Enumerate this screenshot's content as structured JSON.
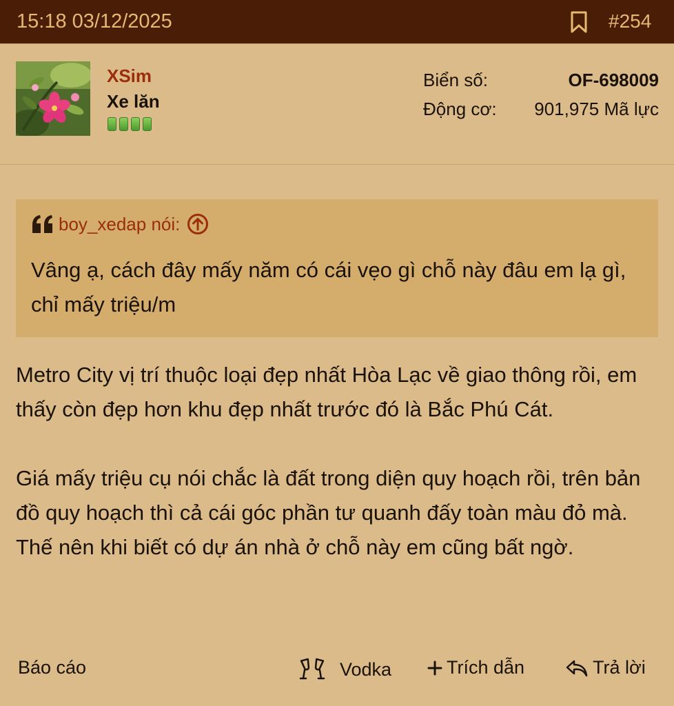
{
  "header": {
    "timestamp": "15:18 03/12/2025",
    "post_number": "#254",
    "bookmark_icon": "bookmark-icon",
    "accent_color": "#e6b872",
    "bg_color": "#4a1e06"
  },
  "author": {
    "username": "XSim",
    "title": "Xe lăn",
    "rank_count": 4,
    "avatar_icon": "flower-avatar",
    "stats": [
      {
        "label": "Biển số:",
        "value": "OF-698009"
      },
      {
        "label": "Động cơ:",
        "value": "901,975 Mã lực"
      }
    ]
  },
  "quote": {
    "author": "boy_xedap nói:",
    "body": "Vâng ạ, cách đây mấy năm có cái vẹo gì chỗ này đâu em lạ gì, chỉ mấy triệu/m"
  },
  "message": {
    "paragraphs": [
      "Metro City vị trí thuộc loại đẹp nhất Hòa Lạc về giao thông rồi, em thấy còn đẹp hơn khu đẹp nhất trước đó là Bắc Phú Cát.",
      "Giá mấy triệu cụ nói chắc là đất trong diện quy hoạch rồi, trên bản đồ quy hoạch thì cả cái góc phần tư quanh đấy toàn màu đỏ mà. Thế nên khi biết có dự án nhà ở chỗ này em cũng bất ngờ."
    ]
  },
  "actions": {
    "report": "Báo cáo",
    "reaction": "Vodka",
    "quote": "Trích dẫn",
    "reply": "Trả lời"
  }
}
